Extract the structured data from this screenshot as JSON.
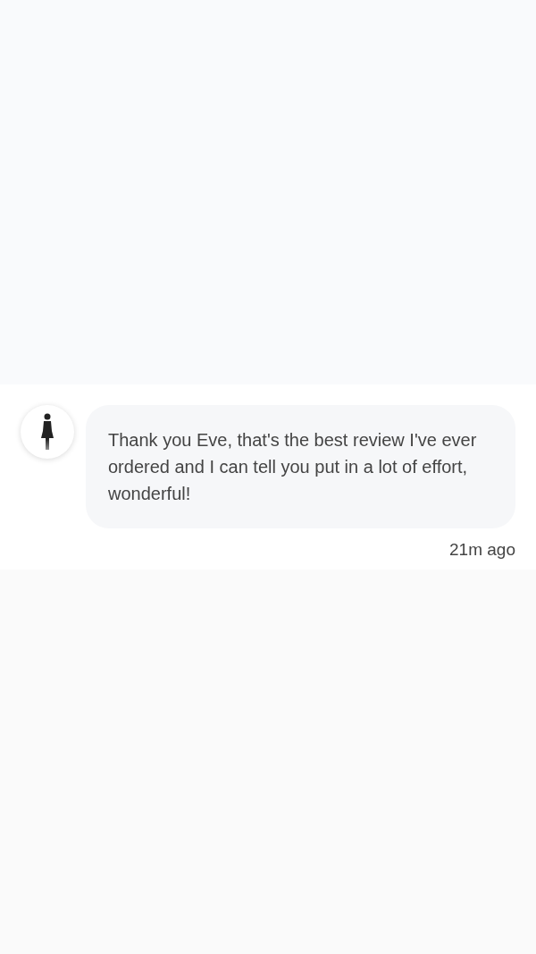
{
  "message": {
    "text": "Thank you Eve, that's the best review I've ever ordered and I can tell you put in a lot of effort, wonderful!",
    "time": "21m ago"
  }
}
